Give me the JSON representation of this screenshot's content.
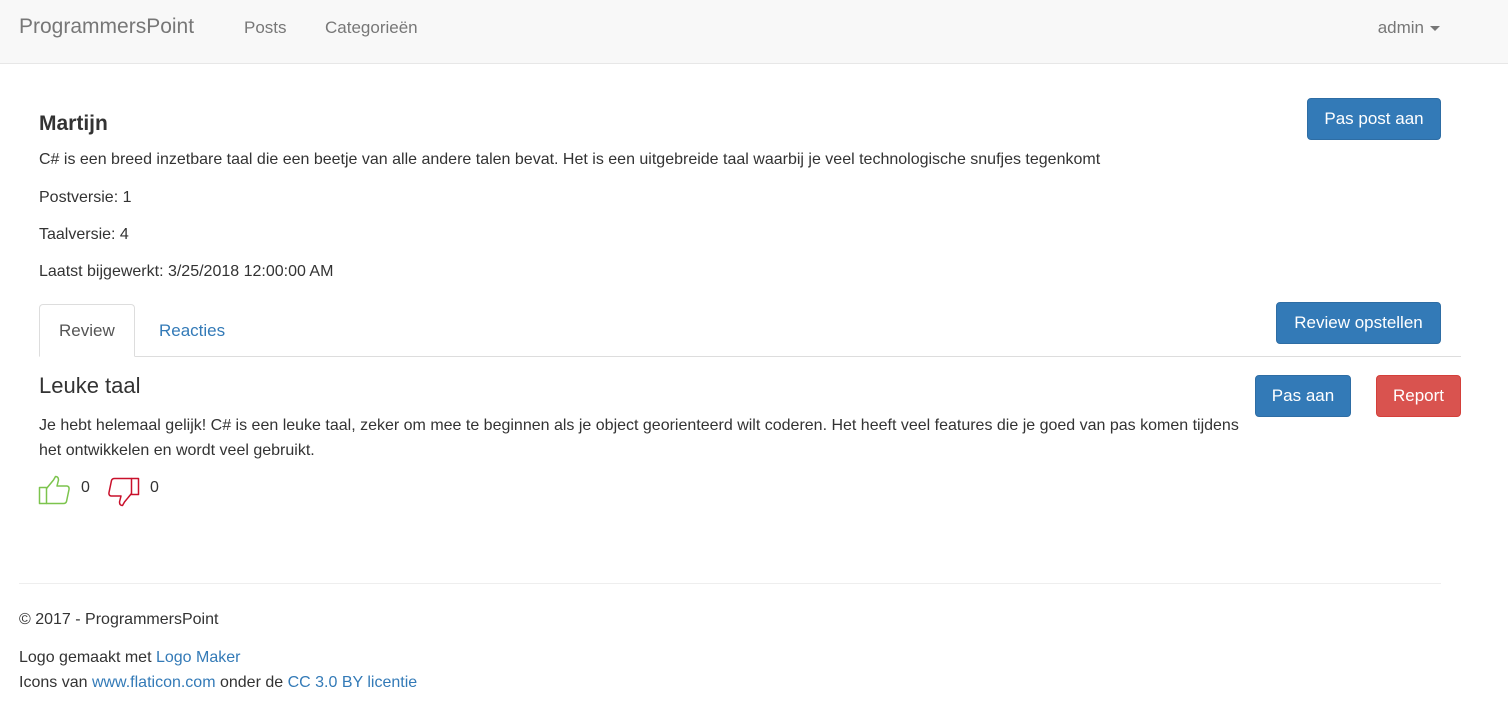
{
  "navbar": {
    "brand": "ProgrammersPoint",
    "links": [
      "Posts",
      "Categorieën"
    ],
    "user": "admin"
  },
  "post": {
    "author": "Martijn",
    "body": "C# is een breed inzetbare taal die een beetje van alle andere talen bevat. Het is een uitgebreide taal waarbij je veel technologische snufjes tegenkomt",
    "post_version": "Postversie: 1",
    "language_version": "Taalversie: 4",
    "last_updated": "Laatst bijgewerkt: 3/25/2018 12:00:00 AM",
    "edit_button": "Pas post aan"
  },
  "tabs": {
    "items": [
      "Review",
      "Reacties"
    ],
    "active": "Review",
    "create_review_button": "Review opstellen"
  },
  "review": {
    "title": "Leuke taal",
    "body": "Je hebt helemaal gelijk! C# is een leuke taal, zeker om mee te beginnen als je object georienteerd wilt coderen. Het heeft veel features die je goed van pas komen tijdens het ontwikkelen en wordt veel gebruikt.",
    "edit_button": "Pas aan",
    "report_button": "Report",
    "likes": "0",
    "dislikes": "0",
    "like_color": "#7cc44d",
    "dislike_color": "#c9102b"
  },
  "footer": {
    "copyright": "© 2017 - ProgrammersPoint",
    "logo_prefix": "Logo gemaakt met ",
    "logo_link": "Logo Maker",
    "icons_prefix": "Icons van ",
    "icons_link": "www.flaticon.com",
    "icons_middle": " onder de ",
    "license_link": "CC 3.0 BY licentie"
  },
  "colors": {
    "primary": "#337ab7",
    "danger": "#d9534f",
    "link": "#337ab7"
  }
}
